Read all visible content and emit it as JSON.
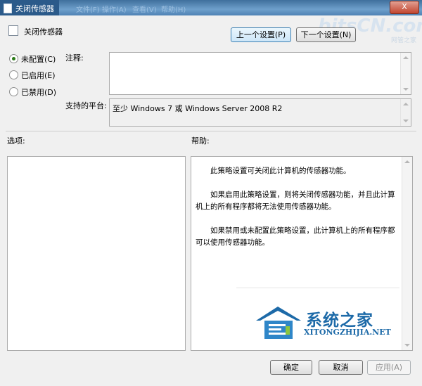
{
  "window": {
    "title": "关闭传感器",
    "blurred_tabs": [
      "文件(F)",
      "操作(A)",
      "查看(V)",
      "帮助(H)"
    ],
    "close_label": "X"
  },
  "watermark_top": {
    "text": "bitsCN.com",
    "sub": "网管之家"
  },
  "header": {
    "title": "关闭传感器"
  },
  "nav": {
    "prev_label": "上一个设置(P)",
    "next_label": "下一个设置(N)"
  },
  "state": {
    "options": [
      {
        "label": "未配置(C)",
        "checked": true
      },
      {
        "label": "已启用(E)",
        "checked": false
      },
      {
        "label": "已禁用(D)",
        "checked": false
      }
    ]
  },
  "comment": {
    "label": "注释:",
    "value": ""
  },
  "platform": {
    "label": "支持的平台:",
    "value": "至少 Windows 7 或 Windows Server 2008 R2"
  },
  "options_section": {
    "label": "选项:"
  },
  "help_section": {
    "label": "帮助:",
    "paragraphs": [
      "此策略设置可关闭此计算机的传感器功能。",
      "如果启用此策略设置，则将关闭传感器功能，并且此计算机上的所有程序都将无法使用传感器功能。",
      "如果禁用或未配置此策略设置，此计算机上的所有程序都可以使用传感器功能。"
    ]
  },
  "watermark": {
    "brand_cn": "系统之家",
    "brand_en": "XITONGZHIJIA.NET"
  },
  "footer": {
    "ok_label": "确定",
    "cancel_label": "取消",
    "apply_label": "应用(A)"
  },
  "colors": {
    "titlebar": "#4f82b4",
    "radio_dot": "#2b7a18",
    "watermark": "#1d6aa8"
  }
}
